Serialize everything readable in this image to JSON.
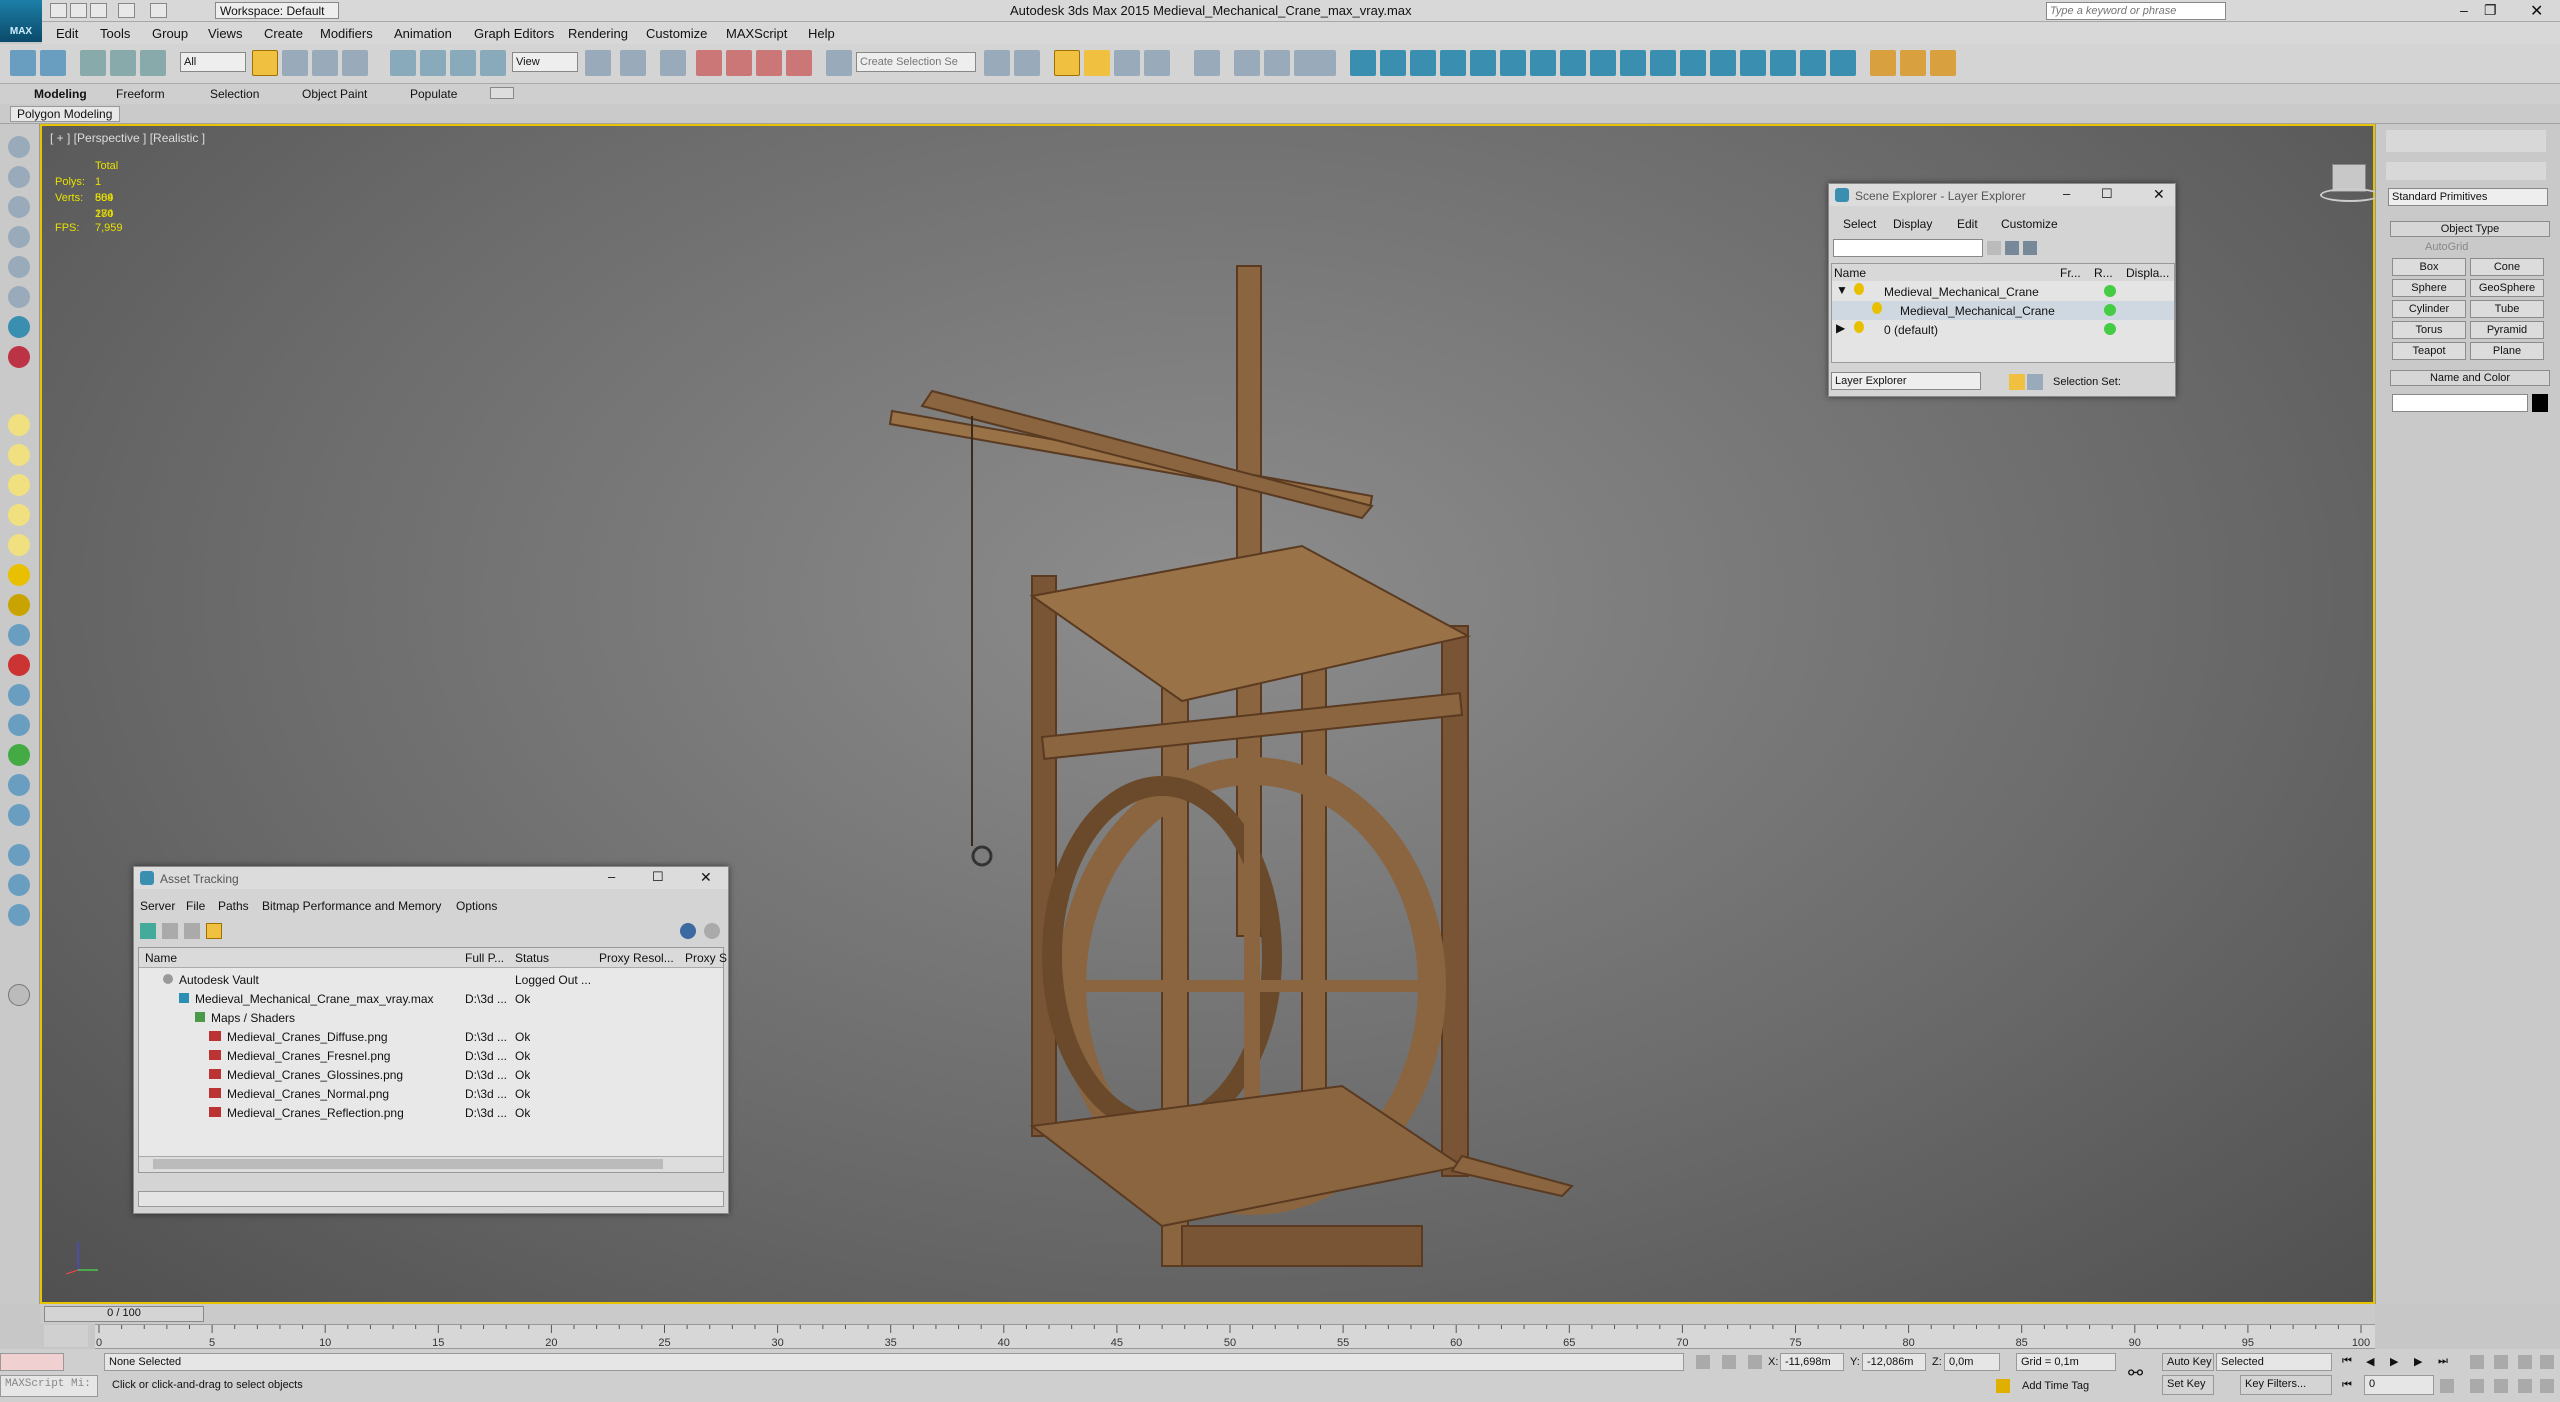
{
  "window": {
    "title": "Autodesk 3ds Max  2015     Medieval_Mechanical_Crane_max_vray.max",
    "logo": "MAX",
    "workspace": "Workspace: Default",
    "search_placeholder": "Type a keyword or phrase"
  },
  "menu": [
    "Edit",
    "Tools",
    "Group",
    "Views",
    "Create",
    "Modifiers",
    "Animation",
    "Graph Editors",
    "Rendering",
    "Customize",
    "MAXScript",
    "Help"
  ],
  "toolbar": {
    "filter": "All",
    "view": "View",
    "selection_set": "Create Selection Se"
  },
  "ribbon": {
    "tabs": [
      "Modeling",
      "Freeform",
      "Selection",
      "Object Paint",
      "Populate"
    ],
    "sub": "Polygon Modeling"
  },
  "viewport": {
    "label": "[ + ] [Perspective ] [Realistic ]",
    "stats_header": "Total",
    "polys_label": "Polys:",
    "polys": "1 589 280",
    "verts_label": "Verts:",
    "verts": "804 174",
    "fps_label": "FPS:",
    "fps": "7,959"
  },
  "scene_explorer": {
    "title": "Scene Explorer - Layer Explorer",
    "menu": [
      "Select",
      "Display",
      "Edit",
      "Customize"
    ],
    "columns": [
      "Name",
      "Fr...",
      "R...",
      "Displa..."
    ],
    "rows": [
      "Medieval_Mechanical_Crane",
      "Medieval_Mechanical_Crane",
      "0 (default)"
    ],
    "footer_dropdown": "Layer Explorer",
    "selection_set": "Selection Set:"
  },
  "asset_tracking": {
    "title": "Asset Tracking",
    "menu": [
      "Server",
      "File",
      "Paths",
      "Bitmap Performance and Memory",
      "Options"
    ],
    "columns": [
      "Name",
      "Full P...",
      "Status",
      "Proxy Resol...",
      "Proxy S"
    ],
    "rows": [
      {
        "name": "Autodesk Vault",
        "path": "",
        "status": "Logged Out ..."
      },
      {
        "name": "Medieval_Mechanical_Crane_max_vray.max",
        "path": "D:\\3d ...",
        "status": "Ok"
      },
      {
        "name": "Maps / Shaders",
        "path": "",
        "status": ""
      },
      {
        "name": "Medieval_Cranes_Diffuse.png",
        "path": "D:\\3d ...",
        "status": "Ok"
      },
      {
        "name": "Medieval_Cranes_Fresnel.png",
        "path": "D:\\3d ...",
        "status": "Ok"
      },
      {
        "name": "Medieval_Cranes_Glossines.png",
        "path": "D:\\3d ...",
        "status": "Ok"
      },
      {
        "name": "Medieval_Cranes_Normal.png",
        "path": "D:\\3d ...",
        "status": "Ok"
      },
      {
        "name": "Medieval_Cranes_Reflection.png",
        "path": "D:\\3d ...",
        "status": "Ok"
      }
    ]
  },
  "command_panel": {
    "category": "Standard Primitives",
    "object_type": "Object Type",
    "autogrid": "AutoGrid",
    "buttons": [
      "Box",
      "Cone",
      "Sphere",
      "GeoSphere",
      "Cylinder",
      "Tube",
      "Torus",
      "Pyramid",
      "Teapot",
      "Plane"
    ],
    "name_color": "Name and Color"
  },
  "timeline": {
    "frame": "0 / 100",
    "ticks": [
      "0",
      "5",
      "10",
      "15",
      "20",
      "25",
      "30",
      "35",
      "40",
      "45",
      "50",
      "55",
      "60",
      "65",
      "70",
      "75",
      "80",
      "85",
      "90",
      "95",
      "100"
    ]
  },
  "status": {
    "selected": "None Selected",
    "prompt": "Click or click-and-drag to select objects",
    "maxscript": "MAXScript Mi:",
    "x_label": "X:",
    "x": "-11,698m",
    "y_label": "Y:",
    "y": "-12,086m",
    "z_label": "Z:",
    "z": "0,0m",
    "grid": "Grid = 0,1m",
    "auto_key": "Auto Key",
    "set_key": "Set Key",
    "key_mode": "Selected",
    "key_filters": "Key Filters...",
    "add_time_tag": "Add Time Tag",
    "frame_field": "0"
  },
  "colors": {
    "viewport_border": "#e8c400",
    "stats": "#e8e000"
  }
}
